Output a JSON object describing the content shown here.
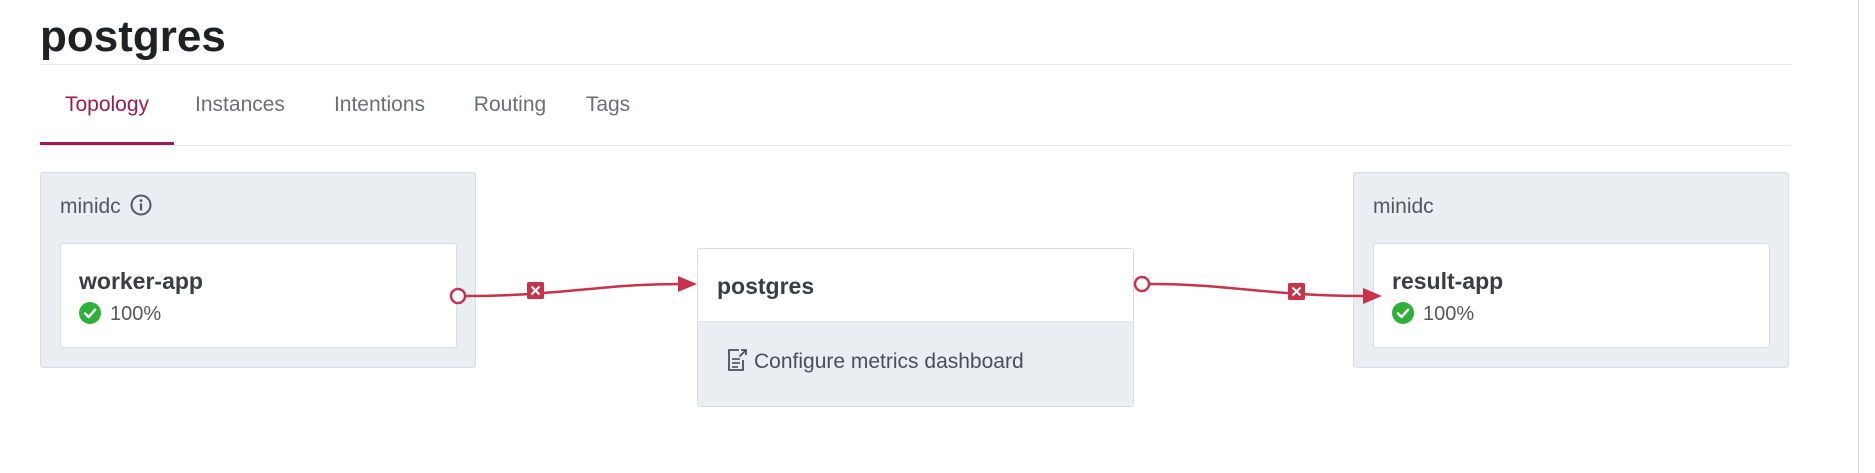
{
  "page": {
    "title": "postgres"
  },
  "tabs": [
    {
      "label": "Topology",
      "active": true
    },
    {
      "label": "Instances",
      "active": false
    },
    {
      "label": "Intentions",
      "active": false
    },
    {
      "label": "Routing",
      "active": false
    },
    {
      "label": "Tags",
      "active": false
    }
  ],
  "topology": {
    "upstream": {
      "datacenter": "minidc",
      "datacenter_icon": "info-icon",
      "service": "worker-app",
      "health_icon": "check-circle-icon",
      "health": "100%"
    },
    "main": {
      "service": "postgres",
      "metrics_icon": "external-doc-icon",
      "metrics_link": "Configure metrics dashboard"
    },
    "downstream": {
      "datacenter": "minidc",
      "service": "result-app",
      "health_icon": "check-circle-icon",
      "health": "100%"
    },
    "connection_status_icon": "deny-x-icon"
  },
  "colors": {
    "accent": "#9b1b53",
    "connector": "#c7334a",
    "health_ok": "#2eb039",
    "panel_bg": "#eaedf1"
  }
}
